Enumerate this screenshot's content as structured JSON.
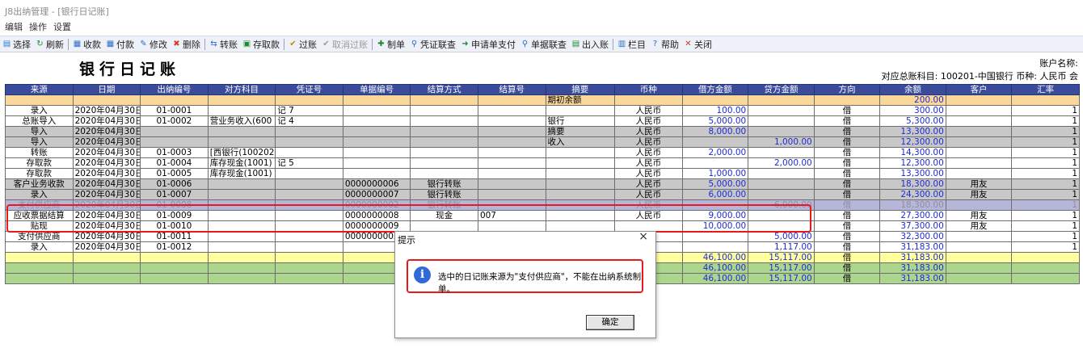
{
  "window": {
    "title": "J8出纳管理 - [银行日记账]"
  },
  "menu": [
    "编辑",
    "操作",
    "设置"
  ],
  "toolbar": [
    {
      "label": "选择",
      "icon": "select-icon",
      "glyph": "▤",
      "color": "#2b7bd6",
      "disabled": false
    },
    {
      "label": "刷新",
      "icon": "refresh-icon",
      "glyph": "↻",
      "color": "#1a8a2e",
      "disabled": false
    },
    {
      "sep": true
    },
    {
      "label": "收款",
      "icon": "receipt-icon",
      "glyph": "▦",
      "color": "#2b6cc4",
      "disabled": false
    },
    {
      "label": "付款",
      "icon": "payment-icon",
      "glyph": "▦",
      "color": "#2b6cc4",
      "disabled": false
    },
    {
      "label": "修改",
      "icon": "edit-icon",
      "glyph": "✎",
      "color": "#2b6cc4",
      "disabled": false
    },
    {
      "label": "删除",
      "icon": "delete-icon",
      "glyph": "✖",
      "color": "#d43a2f",
      "disabled": false
    },
    {
      "sep": true
    },
    {
      "label": "转账",
      "icon": "transfer-icon",
      "glyph": "⇆",
      "color": "#2b6cc4",
      "disabled": false
    },
    {
      "label": "存取款",
      "icon": "deposit-icon",
      "glyph": "▣",
      "color": "#1a8a2e",
      "disabled": false
    },
    {
      "sep": true
    },
    {
      "label": "过账",
      "icon": "post-icon",
      "glyph": "✔",
      "color": "#c08a00",
      "disabled": false
    },
    {
      "label": "取消过账",
      "icon": "unpost-icon",
      "glyph": "✔",
      "color": "#9a9a9a",
      "disabled": true
    },
    {
      "sep": true
    },
    {
      "label": "制单",
      "icon": "make-voucher-icon",
      "glyph": "✚",
      "color": "#1a8a2e",
      "disabled": false
    },
    {
      "label": "凭证联查",
      "icon": "voucher-query-icon",
      "glyph": "⚲",
      "color": "#2b6cc4",
      "disabled": false
    },
    {
      "label": "申请单支付",
      "icon": "apply-pay-icon",
      "glyph": "➜",
      "color": "#1a8a2e",
      "disabled": false
    },
    {
      "label": "单据联查",
      "icon": "bill-query-icon",
      "glyph": "⚲",
      "color": "#2b6cc4",
      "disabled": false
    },
    {
      "label": "出入账",
      "icon": "in-out-icon",
      "glyph": "▤",
      "color": "#1a8a2e",
      "disabled": false
    },
    {
      "sep": true
    },
    {
      "label": "栏目",
      "icon": "columns-icon",
      "glyph": "▥",
      "color": "#2b6cc4",
      "disabled": false
    },
    {
      "label": "帮助",
      "icon": "help-icon",
      "glyph": "?",
      "color": "#2b6cc4",
      "disabled": false
    },
    {
      "label": "关闭",
      "icon": "close-icon",
      "glyph": "✕",
      "color": "#c43a2f",
      "disabled": false
    }
  ],
  "header": {
    "title": "银行日记账",
    "account_name_label": "账户名称:",
    "account_info": "对应总账科目: 100201-中国银行   币种: 人民币   会"
  },
  "table": {
    "columns": [
      "来源",
      "日期",
      "出纳编号",
      "对方科目",
      "凭证号",
      "单据编号",
      "结算方式",
      "结算号",
      "摘要",
      "币种",
      "借方金额",
      "贷方金额",
      "方向",
      "余额",
      "客户",
      "汇率"
    ],
    "rows": [
      {
        "style": "orange",
        "cells": [
          "",
          "",
          "",
          "",
          "",
          "",
          "",
          "",
          "期初余额",
          "",
          "",
          "",
          "",
          "200.00",
          "",
          ""
        ]
      },
      {
        "style": "white",
        "cells": [
          "录入",
          "2020年04月30日",
          "01-0001",
          "",
          "记  7",
          "",
          "",
          "",
          "",
          "人民币",
          "100.00",
          "",
          "借",
          "300.00",
          "",
          "1"
        ]
      },
      {
        "style": "white",
        "cells": [
          "总账导入",
          "2020年04月30日",
          "01-0002",
          "营业务收入(600",
          "记  4",
          "",
          "",
          "",
          "银行",
          "人民币",
          "5,000.00",
          "",
          "借",
          "5,300.00",
          "",
          "1"
        ]
      },
      {
        "style": "gray",
        "cells": [
          "导入",
          "2020年04月30日",
          "",
          "",
          "",
          "",
          "",
          "",
          "摘要",
          "人民币",
          "8,000.00",
          "",
          "借",
          "13,300.00",
          "",
          "1"
        ]
      },
      {
        "style": "gray",
        "cells": [
          "导入",
          "2020年04月30日",
          "",
          "",
          "",
          "",
          "",
          "",
          "收入",
          "人民币",
          "",
          "1,000.00",
          "借",
          "12,300.00",
          "",
          "1"
        ]
      },
      {
        "style": "white",
        "cells": [
          "转账",
          "2020年04月30日",
          "01-0003",
          "[西银行(100202",
          "",
          "",
          "",
          "",
          "",
          "人民币",
          "2,000.00",
          "",
          "借",
          "14,300.00",
          "",
          "1"
        ]
      },
      {
        "style": "white",
        "cells": [
          "存取款",
          "2020年04月30日",
          "01-0004",
          "库存现金(1001)",
          "记  5",
          "",
          "",
          "",
          "",
          "人民币",
          "",
          "2,000.00",
          "借",
          "12,300.00",
          "",
          "1"
        ]
      },
      {
        "style": "white",
        "cells": [
          "存取款",
          "2020年04月30日",
          "01-0005",
          "库存现金(1001)",
          "",
          "",
          "",
          "",
          "",
          "人民币",
          "1,000.00",
          "",
          "借",
          "13,300.00",
          "",
          "1"
        ]
      },
      {
        "style": "gray",
        "cells": [
          "客户业务收款",
          "2020年04月30日",
          "01-0006",
          "",
          "",
          "0000000006",
          "银行转账",
          "",
          "",
          "人民币",
          "5,000.00",
          "",
          "借",
          "18,300.00",
          "用友",
          "1"
        ]
      },
      {
        "style": "gray",
        "cells": [
          "录入",
          "2020年04月30日",
          "01-0007",
          "",
          "",
          "0000000007",
          "银行转账",
          "",
          "",
          "人民币",
          "6,000.00",
          "",
          "借",
          "24,300.00",
          "用友",
          "1"
        ]
      },
      {
        "style": "sel",
        "cells": [
          "支付供应商",
          "2020年04月30日",
          "01-0008",
          "",
          "",
          "0000000002",
          "银行转账",
          "",
          "",
          "人民币",
          "",
          "6,000.00",
          "借",
          "18,300.00",
          "",
          "1"
        ]
      },
      {
        "style": "white",
        "cells": [
          "应收票据结算",
          "2020年04月30日",
          "01-0009",
          "",
          "",
          "0000000008",
          "现金",
          "007",
          "",
          "人民币",
          "9,000.00",
          "",
          "借",
          "27,300.00",
          "用友",
          "1"
        ]
      },
      {
        "style": "white",
        "cells": [
          "贴现",
          "2020年04月30日",
          "01-0010",
          "",
          "",
          "0000000009",
          "",
          "",
          "",
          "",
          "10,000.00",
          "",
          "借",
          "37,300.00",
          "用友",
          "1"
        ]
      },
      {
        "style": "white",
        "cells": [
          "支付供应商",
          "2020年04月30日",
          "01-0011",
          "",
          "",
          "0000000003",
          "",
          "",
          "",
          "",
          "",
          "5,000.00",
          "借",
          "32,300.00",
          "",
          "1"
        ]
      },
      {
        "style": "white",
        "cells": [
          "录入",
          "2020年04月30日",
          "01-0012",
          "",
          "",
          "",
          "",
          "",
          "",
          "",
          "",
          "1,117.00",
          "借",
          "31,183.00",
          "",
          "1"
        ]
      },
      {
        "style": "yellow",
        "cells": [
          "",
          "",
          "",
          "",
          "",
          "",
          "",
          "",
          "",
          "",
          "46,100.00",
          "15,117.00",
          "借",
          "31,183.00",
          "",
          ""
        ]
      },
      {
        "style": "green",
        "cells": [
          "",
          "",
          "",
          "",
          "",
          "",
          "",
          "",
          "",
          "",
          "46,100.00",
          "15,117.00",
          "借",
          "31,183.00",
          "",
          ""
        ]
      },
      {
        "style": "green",
        "cells": [
          "",
          "",
          "",
          "",
          "",
          "",
          "",
          "",
          "",
          "",
          "46,100.00",
          "15,117.00",
          "借",
          "31,183.00",
          "",
          ""
        ]
      }
    ]
  },
  "dialog": {
    "title": "提示",
    "close": "×",
    "icon": "info-icon",
    "message": "选中的日记账来源为\"支付供应商\"，不能在出纳系统制单。",
    "ok_label": "确定"
  },
  "colors": {
    "header_bg": "#3a4b9a",
    "highlight_red": "#e8191b",
    "amount_blue": "#1d2bd6"
  }
}
